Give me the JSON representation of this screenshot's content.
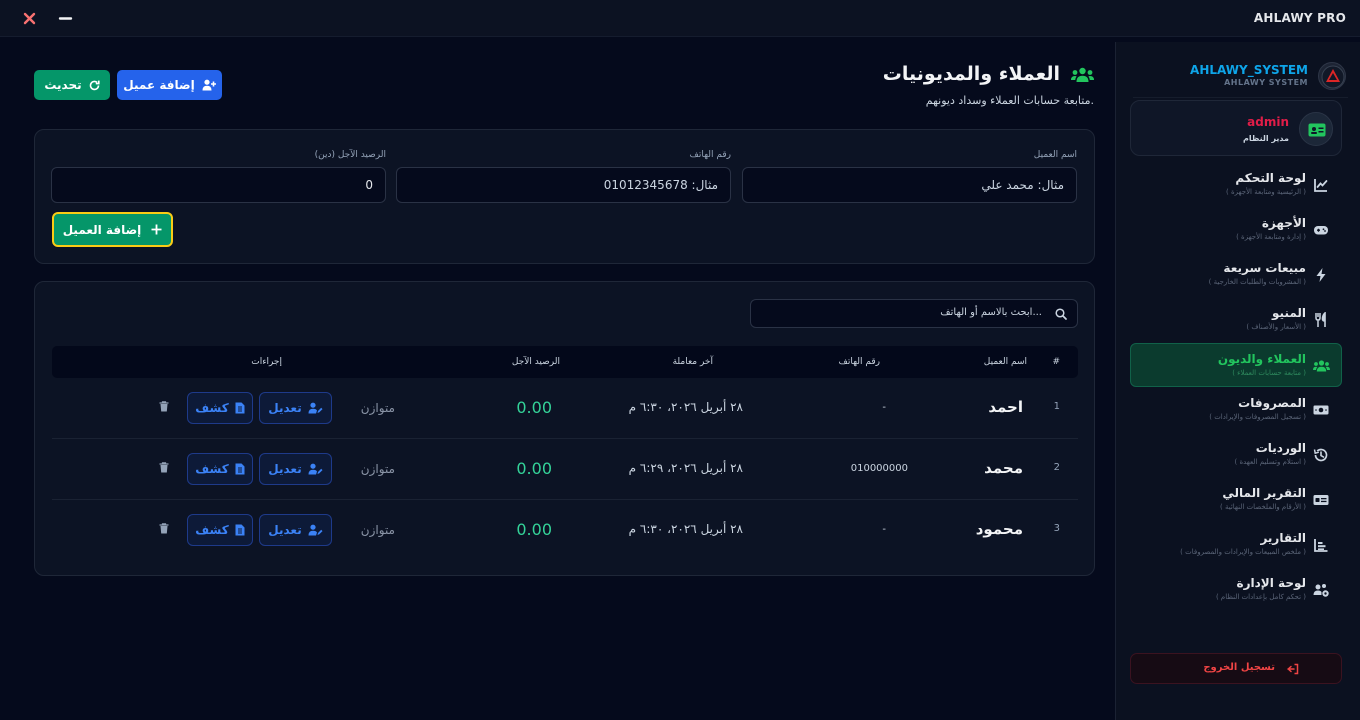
{
  "app": {
    "title": "AHLAWY PRO"
  },
  "sidebar": {
    "brand_name": "AHLAWY_SYSTEM",
    "brand_sub": "AHLAWY SYSTEM",
    "user_name": "admin",
    "user_role": "مدير النظام",
    "items": [
      {
        "label": "لوحة التحكم",
        "sub": "( الرئيسية ومتابعة الأجهزة )",
        "icon": "chart-line-icon",
        "active": false
      },
      {
        "label": "الأجهزة",
        "sub": "( إدارة ومتابعة الأجهزة )",
        "icon": "gamepad-icon",
        "active": false
      },
      {
        "label": "مبيعات سريعة",
        "sub": "( المشروبات والطلبات الخارجية )",
        "icon": "bolt-icon",
        "active": false
      },
      {
        "label": "المنيو",
        "sub": "( الأسعار والأصناف )",
        "icon": "utensils-icon",
        "active": false
      },
      {
        "label": "العملاء والديون",
        "sub": "( متابعة حسابات العملاء )",
        "icon": "users-icon",
        "active": true
      },
      {
        "label": "المصروفات",
        "sub": "( تسجيل المصروفات والإيرادات )",
        "icon": "money-icon",
        "active": false
      },
      {
        "label": "الورديات",
        "sub": "( استلام وتسليم العهدة )",
        "icon": "history-icon",
        "active": false
      },
      {
        "label": "التقرير المالي",
        "sub": "( الأرقام والملخصات النهائية )",
        "icon": "receipt-icon",
        "active": false
      },
      {
        "label": "التقارير",
        "sub": "( ملخص المبيعات والإيرادات والمصروفات )",
        "icon": "bar-chart-icon",
        "active": false
      },
      {
        "label": "لوحة الإدارة",
        "sub": "( تحكم كامل بإعدادات النظام )",
        "icon": "users-gear-icon",
        "active": false
      }
    ],
    "logout_label": "تسجيل الخروج"
  },
  "header": {
    "title": "العملاء والمديونيات",
    "subtitle": "متابعة حسابات العملاء وسداد ديونهم.",
    "add_client_label": "إضافة عميل",
    "refresh_label": "تحديث"
  },
  "form": {
    "name_label": "اسم العميل",
    "name_placeholder": "مثال: محمد علي",
    "phone_label": "رقم الهاتف",
    "phone_placeholder": "مثال: 01012345678",
    "balance_label": "الرصيد الآجل (دين)",
    "balance_value": "0",
    "submit_label": "إضافة العميل"
  },
  "table": {
    "search_placeholder": "ابحث بالاسم أو الهاتف...",
    "headers": {
      "idx": "#",
      "name": "اسم العميل",
      "phone": "رقم الهاتف",
      "last": "آخر معاملة",
      "balance": "الرصيد الآجل",
      "actions": "إجراءات"
    },
    "edit_label": "تعديل",
    "view_label": "كشف",
    "rows": [
      {
        "idx": "1",
        "name": "احمد",
        "phone": "-",
        "date": "٢٨ أبريل ٢٠٢٦، ٦:٣٠ م",
        "balance": "0.00",
        "status": "متوازن"
      },
      {
        "idx": "2",
        "name": "محمد",
        "phone": "010000000",
        "date": "٢٨ أبريل ٢٠٢٦، ٦:٢٩ م",
        "balance": "0.00",
        "status": "متوازن"
      },
      {
        "idx": "3",
        "name": "محمود",
        "phone": "-",
        "date": "٢٨ أبريل ٢٠٢٦، ٦:٣٠ م",
        "balance": "0.00",
        "status": "متوازن"
      }
    ]
  },
  "colors": {
    "accent_green": "#059669",
    "accent_blue": "#2563eb",
    "active_nav": "#22c55e",
    "danger": "#ef4444",
    "focus_ring": "#facc15"
  }
}
